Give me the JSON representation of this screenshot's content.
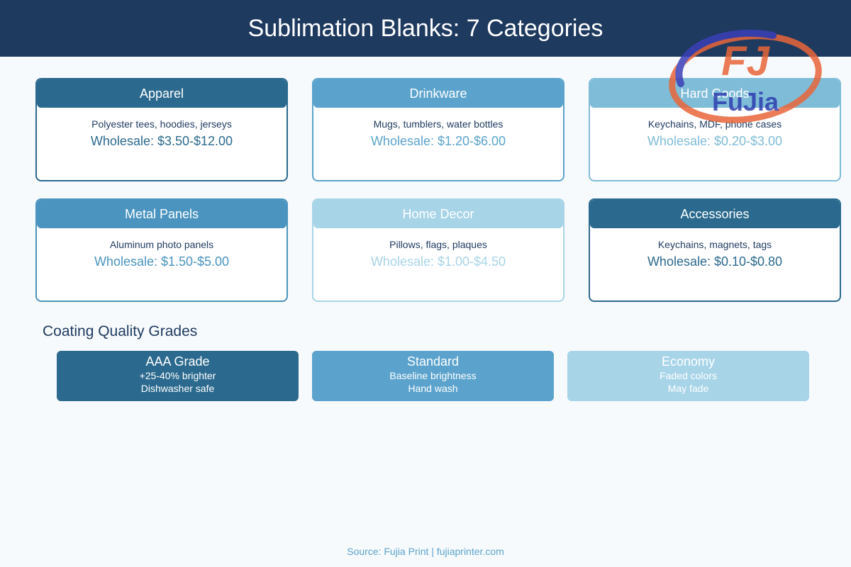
{
  "header": {
    "title": "Sublimation Blanks: 7 Categories"
  },
  "colors": {
    "dark": "#2b6a8e",
    "mid": "#4a94bf",
    "light": "#5ba3cc",
    "pale": "#7fbcd8",
    "palest": "#a8d4e8",
    "navy": "#1e3a5f"
  },
  "categories": [
    {
      "title": "Apparel",
      "description": "Polyester tees, hoodies, jerseys",
      "price": "Wholesale: $3.50-$12.00"
    },
    {
      "title": "Drinkware",
      "description": "Mugs, tumblers, water bottles",
      "price": "Wholesale: $1.20-$6.00"
    },
    {
      "title": "Hard Goods",
      "description": "Keychains, MDF, phone cases",
      "price": "Wholesale: $0.20-$3.00"
    },
    {
      "title": "Metal Panels",
      "description": "Aluminum photo panels",
      "price": "Wholesale: $1.50-$5.00"
    },
    {
      "title": "Home Decor",
      "description": "Pillows, flags, plaques",
      "price": "Wholesale: $1.00-$4.50"
    },
    {
      "title": "Accessories",
      "description": "Keychains, magnets, tags",
      "price": "Wholesale: $0.10-$0.80"
    }
  ],
  "grades_section": {
    "title": "Coating Quality Grades",
    "grades": [
      {
        "title": "AAA Grade",
        "line1": "+25-40% brighter",
        "line2": "Dishwasher safe"
      },
      {
        "title": "Standard",
        "line1": "Baseline brightness",
        "line2": "Hand wash"
      },
      {
        "title": "Economy",
        "line1": "Faded colors",
        "line2": "May fade"
      }
    ]
  },
  "logo": {
    "mark": "FJ",
    "name": "FuJia"
  },
  "footer": {
    "source": "Source: Fujia Print | fujiaprinter.com"
  }
}
